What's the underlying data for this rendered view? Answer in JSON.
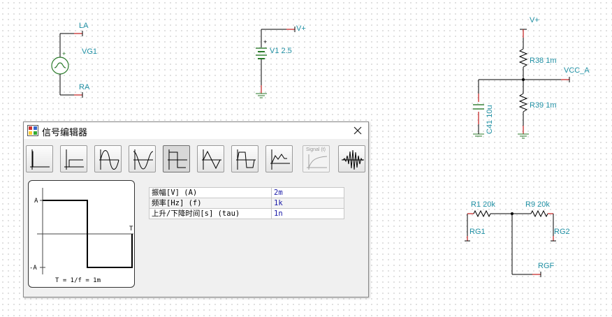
{
  "schematic": {
    "vg1": {
      "name": "VG1",
      "pos_terminal": "LA",
      "neg_terminal": "RA",
      "plus_mark": "+"
    },
    "v1": {
      "label": "V1 2.5",
      "terminal": "V+",
      "plus_mark": "+"
    },
    "divider": {
      "supply": "V+",
      "r_top": "R38 1m",
      "r_bottom": "R39 1m",
      "cap": "C41 10u",
      "output": "VCC_A"
    },
    "gain_net": {
      "r1": "R1 20k",
      "r9": "R9 20k",
      "rg1": "RG1",
      "rg2": "RG2",
      "rgf": "RGF"
    }
  },
  "dialog": {
    "title": "信号编辑器",
    "toolbar": [
      {
        "icon": "step-wave-icon"
      },
      {
        "icon": "pulse-wave-icon"
      },
      {
        "icon": "sine-wave-icon"
      },
      {
        "icon": "cosine-wave-icon"
      },
      {
        "icon": "square-wave-icon",
        "active": true
      },
      {
        "icon": "triangle-wave-icon"
      },
      {
        "icon": "trapezoid-wave-icon"
      },
      {
        "icon": "general-wave-icon"
      },
      {
        "icon": "signal-t-icon",
        "label": "Signal (t)",
        "disabled": true
      },
      {
        "icon": "burst-wave-icon"
      }
    ],
    "preview": {
      "top_label": "A",
      "bottom_label": "-A",
      "period_label": "T",
      "formula": "T = 1/f = 1m"
    },
    "properties": [
      {
        "name": "振幅[V] (A)",
        "value": "2m"
      },
      {
        "name": "频率[Hz] (f)",
        "value": "1k"
      },
      {
        "name": "上升/下降时间[s] (tau)",
        "value": "1n"
      }
    ]
  },
  "colors": {
    "label": "#1f8fa3",
    "pin": "#c31a1a",
    "wire": "#000000",
    "value": "#1a1aa8"
  }
}
